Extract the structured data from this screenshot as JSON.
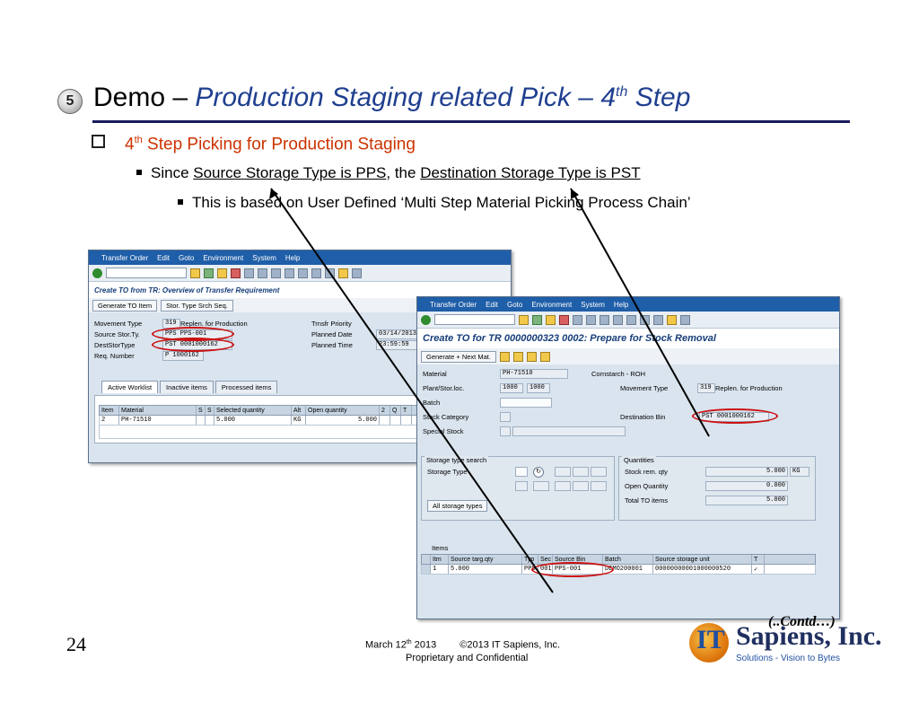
{
  "slide": {
    "step_number": "5",
    "title_plain": "Demo – ",
    "title_italic": "Production Staging related Pick – 4",
    "title_sup": "th",
    "title_end": " Step",
    "bullet1_pre": "4",
    "bullet1_sup": "th",
    "bullet1_text": " Step Picking for Production Staging",
    "bullet2_a": "Since ",
    "bullet2_u1": "Source Storage Type is PPS",
    "bullet2_b": ", the ",
    "bullet2_u2": "Destination Storage Type is PST",
    "bullet3": "This is based on User Defined ‘Multi Step Material Picking Process Chain’",
    "page_number": "24",
    "footer_date_pre": "March 12",
    "footer_date_sup": "th",
    "footer_date_post": " 2013",
    "footer_copyright": "©2013 IT Sapiens, Inc.",
    "footer_conf": "Proprietary and Confidential",
    "contd": "(..Contd…)"
  },
  "logo": {
    "text_it": "IT",
    "text_name": "Sapiens, Inc.",
    "tagline": "Solutions - Vision to Bytes",
    "colors": {
      "blue": "#1f4fa0",
      "orange": "#e07a10"
    }
  },
  "win1": {
    "menu": [
      "Transfer Order",
      "Edit",
      "Goto",
      "Environment",
      "System",
      "Help"
    ],
    "title": "Create TO from TR: Overview of Transfer Requirement",
    "buttons": [
      "Generate TO Item",
      "Stor. Type Srch Seq."
    ],
    "fields": {
      "movement_type_label": "Movement Type",
      "movement_type_code": "319",
      "movement_type_text": "Replen. for Production",
      "source_label": "Source Stor.Ty.",
      "source_value": "PPS PPS-001",
      "dest_label": "DestStorType",
      "dest_value": "PST 0001000162",
      "req_label": "Req. Number",
      "req_value": "P 1000162",
      "prio_label": "Trnsfr Priority",
      "pdate_label": "Planned Date",
      "pdate_value": "03/14/2013",
      "ptime_label": "Planned Time",
      "ptime_value": "23:59:59"
    },
    "tabs": [
      "Active Worklist",
      "Inactive items",
      "Processed items"
    ],
    "grid_headers": [
      "Item",
      "Material",
      "S",
      "S",
      "Selected quantity",
      "Alt",
      "Open quantity",
      "2",
      "Q",
      "T"
    ],
    "grid_row": [
      "2",
      "PH-71510",
      "",
      "",
      "5.000",
      "KG",
      "5.000",
      "",
      "",
      ""
    ]
  },
  "win2": {
    "menu": [
      "Transfer Order",
      "Edit",
      "Goto",
      "Environment",
      "System",
      "Help"
    ],
    "title": "Create TO for TR 0000000323 0002: Prepare for Stock Removal",
    "buttons": [
      "Generate + Next Mat."
    ],
    "fields": {
      "material_label": "Material",
      "material_value": "PH-71510",
      "material_desc": "Cornstarch - ROH",
      "plant_label": "Plant/Stor.loc.",
      "plant_value": "1000",
      "sloc_value": "1000",
      "batch_label": "Batch",
      "stockcat_label": "Stock Category",
      "special_label": "Special Stock",
      "movtype_label": "Movement Type",
      "movtype_code": "319",
      "movtype_text": "Replen. for Production",
      "destbin_label": "Destination Bin",
      "destbin_value": "PST 0001000162"
    },
    "search_group": {
      "title": "Storage type search",
      "storage_type_label": "Storage Type",
      "all_types_button": "All storage types"
    },
    "qty_group": {
      "title": "Quantities",
      "stock_rem_label": "Stock rem. qty",
      "stock_rem_value": "5.000",
      "stock_rem_unit": "KG",
      "open_qty_label": "Open Quantity",
      "open_qty_value": "0.000",
      "total_to_label": "Total TO items",
      "total_to_value": "5.000"
    },
    "items": {
      "title": "Items",
      "headers": [
        "Itm",
        "Source targ.qty",
        "Typ",
        "Sec",
        "Source Bin",
        "Batch",
        "Source storage unit",
        "T"
      ],
      "row": [
        "1",
        "5.000",
        "PPS",
        "001",
        "PPS-001",
        "DEMO200001",
        "00000000001000000520",
        "✓"
      ]
    }
  }
}
